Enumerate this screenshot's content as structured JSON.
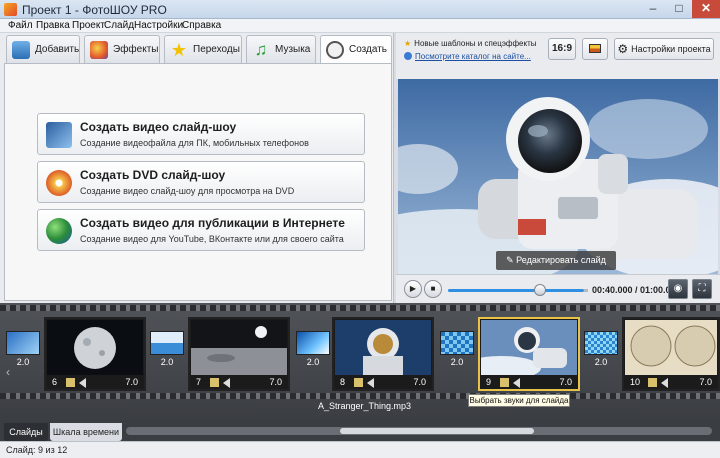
{
  "window": {
    "title": "Проект 1 - ФотоШОУ PRO",
    "min": "–",
    "max": "□",
    "close": "✕"
  },
  "menu": [
    "Файл",
    "Правка",
    "Проект",
    "Слайд",
    "Настройки",
    "Справка"
  ],
  "tabs": [
    {
      "label": "Добавить",
      "icon": "photos-icon"
    },
    {
      "label": "Эффекты",
      "icon": "palette-icon"
    },
    {
      "label": "Переходы",
      "icon": "star-icon"
    },
    {
      "label": "Музыка",
      "icon": "music-note-icon"
    },
    {
      "label": "Создать",
      "icon": "film-reel-icon"
    }
  ],
  "actions": [
    {
      "title": "Создать видео слайд-шоу",
      "desc": "Создание видеофайла для ПК, мобильных телефонов",
      "icon": "video-device-icon"
    },
    {
      "title": "Создать DVD слайд-шоу",
      "desc": "Создание видео слайд-шоу для просмотра на DVD",
      "icon": "dvd-disc-icon"
    },
    {
      "title": "Создать видео для публикации в Интернете",
      "desc": "Создание видео для YouTube, ВКонтакте или для своего сайта",
      "icon": "globe-icon"
    }
  ],
  "news": {
    "text": "Новые шаблоны и спецэффекты",
    "link": "Посмотрите каталог на сайте..."
  },
  "toolbar": {
    "ratio": "16:9",
    "settings": "Настройки проекта"
  },
  "preview": {
    "edit_button": "Редактировать слайд"
  },
  "player": {
    "time": "00:40.000 / 01:00.000",
    "play": "▶",
    "stop": "■",
    "snapshot": "◉",
    "fullscreen": "⛶",
    "progress": 0.667
  },
  "slides": [
    {
      "num": "6",
      "dur": "7.0",
      "theme": "moon"
    },
    {
      "num": "7",
      "dur": "7.0",
      "theme": "lunar"
    },
    {
      "num": "8",
      "dur": "7.0",
      "theme": "astronaut"
    },
    {
      "num": "9",
      "dur": "7.0",
      "theme": "astronaut2",
      "selected": true
    },
    {
      "num": "10",
      "dur": "7.0",
      "theme": "map"
    }
  ],
  "transitions": [
    "2.0",
    "2.0",
    "2.0",
    "2.0"
  ],
  "first_transition": "2.0",
  "audio_track": "A_Stranger_Thing.mp3",
  "tooltip": "Выбрать звуки для слайда",
  "bottom_tabs": {
    "slides": "Слайды",
    "timeline": "Шкала времени"
  },
  "status": "Слайд: 9 из 12"
}
